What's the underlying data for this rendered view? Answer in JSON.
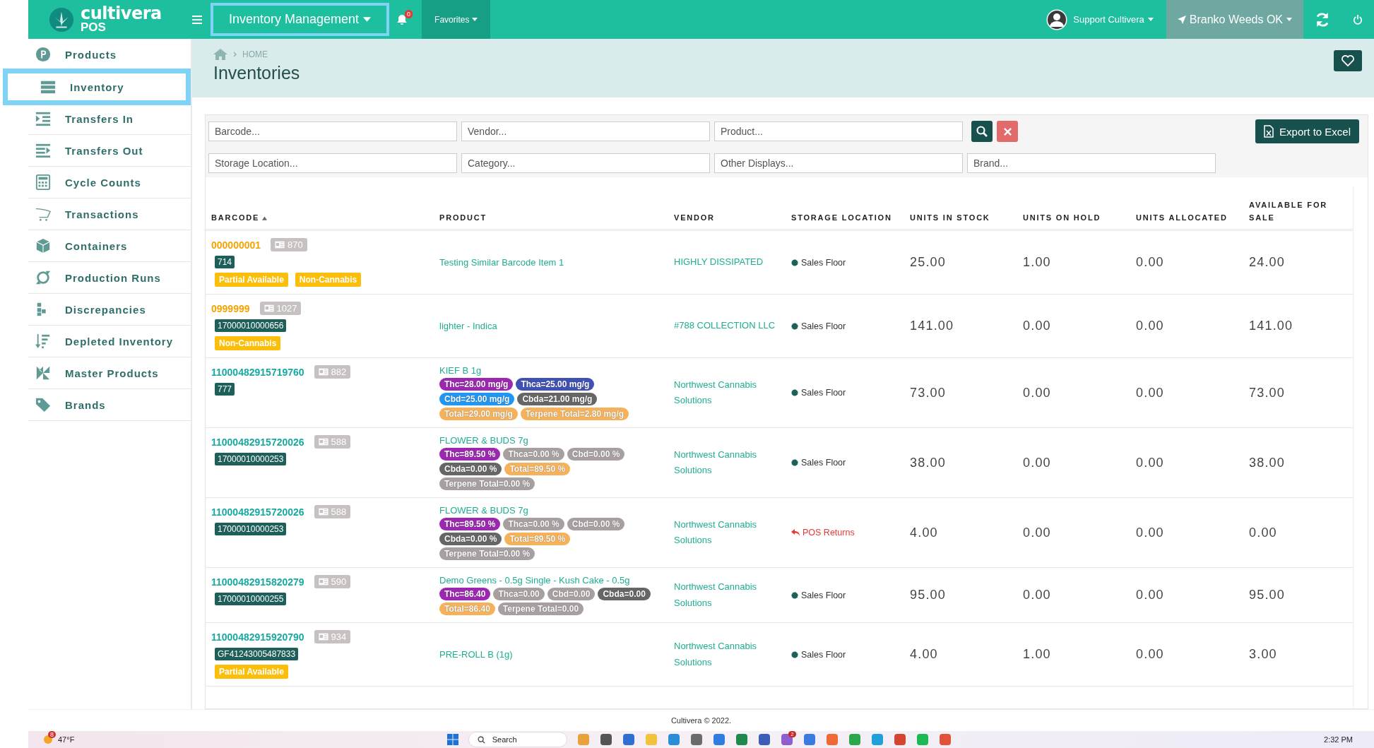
{
  "top_bar": {
    "logo": {
      "name": "cultivera",
      "sub": "POS"
    },
    "module": {
      "label": "Inventory Management",
      "selected": true
    },
    "notifications": "0",
    "favorites": "Favorites",
    "user": "Support Cultivera",
    "store": "Branko Weeds OK"
  },
  "sidebar": {
    "items": [
      {
        "label": "Products",
        "selected": false
      },
      {
        "label": "Inventory",
        "selected": true
      },
      {
        "label": "Transfers In",
        "selected": false
      },
      {
        "label": "Transfers Out",
        "selected": false
      },
      {
        "label": "Cycle Counts",
        "selected": false
      },
      {
        "label": "Transactions",
        "selected": false
      },
      {
        "label": "Containers",
        "selected": false
      },
      {
        "label": "Production Runs",
        "selected": false
      },
      {
        "label": "Discrepancies",
        "selected": false
      },
      {
        "label": "Depleted Inventory",
        "selected": false
      },
      {
        "label": "Master Products",
        "selected": false
      },
      {
        "label": "Brands",
        "selected": false
      }
    ]
  },
  "header": {
    "breadcrumb": "HOME",
    "title": "Inventories"
  },
  "filters": {
    "row_1": [
      {
        "placeholder": "Barcode..."
      },
      {
        "placeholder": "Vendor..."
      },
      {
        "placeholder": "Product..."
      }
    ],
    "row_2": [
      {
        "placeholder": "Storage Location..."
      },
      {
        "placeholder": "Category..."
      },
      {
        "placeholder": "Other Displays..."
      },
      {
        "placeholder": "Brand..."
      }
    ],
    "export": "Export to Excel"
  },
  "table": {
    "columns": [
      {
        "label": "BARCODE",
        "sorted": true
      },
      {
        "label": "PRODUCT",
        "sorted": false
      },
      {
        "label": "VENDOR",
        "sorted": false
      },
      {
        "label": "STORAGE LOCATION",
        "sorted": false
      },
      {
        "label": "UNITS IN STOCK",
        "sorted": false
      },
      {
        "label": "UNITS ON HOLD",
        "sorted": false
      },
      {
        "label": "UNITS ALLOCATED",
        "sorted": false
      },
      {
        "label": "AVAILABLE FOR SALE",
        "sorted": false
      }
    ],
    "rows": [
      {
        "barcode": {
          "text": "000000001",
          "color": "#f5a300"
        },
        "count": "870",
        "codes": [
          "714"
        ],
        "tags": [
          "Partial Available",
          "Non-Cannabis"
        ],
        "product": "Testing Similar Barcode Item 1",
        "chips": [],
        "vendor": "HIGHLY DISSIPATED",
        "location": {
          "kind": "floor",
          "text": "Sales Floor"
        },
        "in_stock": "25.00",
        "on_hold": "1.00",
        "allocated": "0.00",
        "available": "24.00"
      },
      {
        "barcode": {
          "text": "0999999",
          "color": "#f5a300"
        },
        "count": "1027",
        "codes": [
          "17000010000656"
        ],
        "tags": [
          "Non-Cannabis"
        ],
        "product": "lighter - Indica",
        "chips": [],
        "vendor": "#788 COLLECTION LLC",
        "location": {
          "kind": "floor",
          "text": "Sales Floor"
        },
        "in_stock": "141.00",
        "on_hold": "0.00",
        "allocated": "0.00",
        "available": "141.00"
      },
      {
        "barcode": {
          "text": "11000482915719760",
          "color": "#17a9a0"
        },
        "count": "882",
        "codes": [
          "777"
        ],
        "tags": [],
        "product": "KIEF B 1g",
        "chips": [
          {
            "text": "Thc=28.00 mg/g",
            "color": "#9c27b0"
          },
          {
            "text": "Thca=25.00 mg/g",
            "color": "#3f51b5"
          },
          {
            "text": "Cbd=25.00 mg/g",
            "color": "#2196f3"
          },
          {
            "text": "Cbda=21.00 mg/g",
            "color": "#666666"
          },
          {
            "text": "Total=29.00 mg/g",
            "color": "#f5b25a"
          },
          {
            "text": "Terpene Total=2.80 mg/g",
            "color": "#f5b25a"
          }
        ],
        "vendor": "Northwest Cannabis Solutions",
        "location": {
          "kind": "floor",
          "text": "Sales Floor"
        },
        "in_stock": "73.00",
        "on_hold": "0.00",
        "allocated": "0.00",
        "available": "73.00"
      },
      {
        "barcode": {
          "text": "11000482915720026",
          "color": "#17a9a0"
        },
        "count": "588",
        "codes": [
          "17000010000253"
        ],
        "tags": [],
        "product": "FLOWER & BUDS 7g",
        "chips": [
          {
            "text": "Thc=89.50 %",
            "color": "#9c27b0"
          },
          {
            "text": "Thca=0.00 %",
            "color": "#a8a0a0"
          },
          {
            "text": "Cbd=0.00 %",
            "color": "#a8a0a0"
          },
          {
            "text": "Cbda=0.00 %",
            "color": "#666666"
          },
          {
            "text": "Total=89.50 %",
            "color": "#f5b25a"
          },
          {
            "text": "Terpene Total=0.00 %",
            "color": "#a8a0a0"
          }
        ],
        "vendor": "Northwest Cannabis Solutions",
        "location": {
          "kind": "floor",
          "text": "Sales Floor"
        },
        "in_stock": "38.00",
        "on_hold": "0.00",
        "allocated": "0.00",
        "available": "38.00"
      },
      {
        "barcode": {
          "text": "11000482915720026",
          "color": "#17a9a0"
        },
        "count": "588",
        "codes": [
          "17000010000253"
        ],
        "tags": [],
        "product": "FLOWER & BUDS 7g",
        "chips": [
          {
            "text": "Thc=89.50 %",
            "color": "#9c27b0"
          },
          {
            "text": "Thca=0.00 %",
            "color": "#a8a0a0"
          },
          {
            "text": "Cbd=0.00 %",
            "color": "#a8a0a0"
          },
          {
            "text": "Cbda=0.00 %",
            "color": "#666666"
          },
          {
            "text": "Total=89.50 %",
            "color": "#f5b25a"
          },
          {
            "text": "Terpene Total=0.00 %",
            "color": "#a8a0a0"
          }
        ],
        "vendor": "Northwest Cannabis Solutions",
        "location": {
          "kind": "returns",
          "text": "POS Returns"
        },
        "in_stock": "4.00",
        "on_hold": "0.00",
        "allocated": "0.00",
        "available": "0.00"
      },
      {
        "barcode": {
          "text": "11000482915820279",
          "color": "#17a9a0"
        },
        "count": "590",
        "codes": [
          "17000010000255"
        ],
        "tags": [],
        "product": "Demo Greens - 0.5g Single - Kush Cake - 0.5g",
        "chips": [
          {
            "text": "Thc=86.40",
            "color": "#9c27b0"
          },
          {
            "text": "Thca=0.00",
            "color": "#a8a0a0"
          },
          {
            "text": "Cbd=0.00",
            "color": "#a8a0a0"
          },
          {
            "text": "Cbda=0.00",
            "color": "#666666"
          },
          {
            "text": "Total=86.40",
            "color": "#f5b25a"
          },
          {
            "text": "Terpene Total=0.00",
            "color": "#a8a0a0"
          }
        ],
        "vendor": "Northwest Cannabis Solutions",
        "location": {
          "kind": "floor",
          "text": "Sales Floor"
        },
        "in_stock": "95.00",
        "on_hold": "0.00",
        "allocated": "0.00",
        "available": "95.00"
      },
      {
        "barcode": {
          "text": "11000482915920790",
          "color": "#17a9a0"
        },
        "count": "934",
        "codes": [
          "GF41243005487833"
        ],
        "tags": [
          "Partial Available"
        ],
        "product": "PRE-ROLL B (1g)",
        "chips": [],
        "vendor": "Northwest Cannabis Solutions",
        "location": {
          "kind": "floor",
          "text": "Sales Floor"
        },
        "in_stock": "4.00",
        "on_hold": "1.00",
        "allocated": "0.00",
        "available": "3.00"
      }
    ]
  },
  "footer": "Cultivera © 2022.",
  "taskbar": {
    "weather_badge": "8",
    "weather": "47°F",
    "search": "Search",
    "app_badge": "2",
    "time": "2:32 PM"
  }
}
